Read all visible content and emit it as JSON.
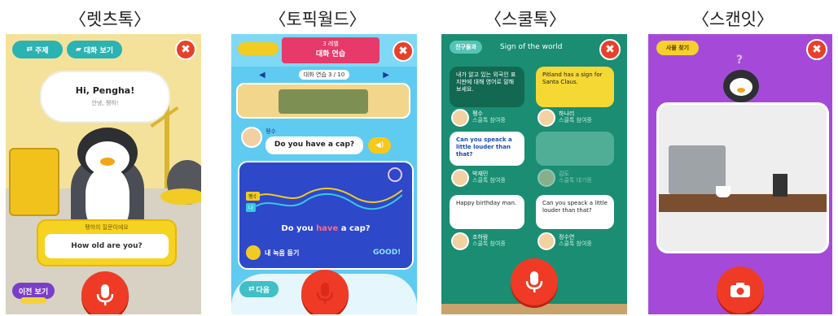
{
  "captions": [
    "〈렛츠톡〉",
    "〈토픽월드〉",
    "〈스쿨톡〉",
    "〈스캔잇〉"
  ],
  "letstalk": {
    "top_left_btn": "주제",
    "top_mid_btn": "대화 보기",
    "close": "✖",
    "greeting": "Hi, Pengha!",
    "greeting_sub": "안녕, 펭하!",
    "question_title": "펭하의 질문이에요",
    "question": "How old are you?",
    "bottom_btn": "이전 보기"
  },
  "topicworld": {
    "banner_top": "3 레벨",
    "banner_title": "대화 연습",
    "nav_label": "대화 연습 3 / 10",
    "speaker_name": "펭수",
    "speech": "Do you have a cap?",
    "graph_tag1": "펭수",
    "graph_tag2": "나",
    "sentence_pre": "Do you ",
    "sentence_highlight": "have",
    "sentence_post": " a cap?",
    "my_record": "내 녹음 듣기",
    "score": "GOOD!",
    "bottom_btn": "다음",
    "close": "✖"
  },
  "schooltalk": {
    "tag": "친구들과",
    "title": "Sign of the world",
    "close": "✖",
    "messages": [
      {
        "text": "내가 알고 있는 외국인 표지판에 대해 영어로 말해보세요.",
        "style": "dark"
      },
      {
        "text": "Pitland has a sign for Santa Claus.",
        "style": "yellow"
      },
      {
        "text": "Can you speack a little louder than that?",
        "style": "white"
      },
      {
        "text": "",
        "style": "faded"
      },
      {
        "text": "Happy birthday man.",
        "style": "white"
      },
      {
        "text": "Can you speack a little louder than that?",
        "style": "white"
      }
    ],
    "people": [
      {
        "name": "펭수",
        "sub": "스쿨톡 참여중"
      },
      {
        "name": "하나리",
        "sub": "스쿨톡 참여중"
      },
      {
        "name": "박재민",
        "sub": "스쿨톡 참여중"
      },
      {
        "name": "김도",
        "sub": "스쿨톡 대기중"
      },
      {
        "name": "조하람",
        "sub": "스쿨톡 참여중"
      },
      {
        "name": "정수연",
        "sub": "스쿨톡 참여중"
      }
    ]
  },
  "scanit": {
    "tag": "사물 찾기",
    "hint": "?",
    "close": "✖"
  }
}
